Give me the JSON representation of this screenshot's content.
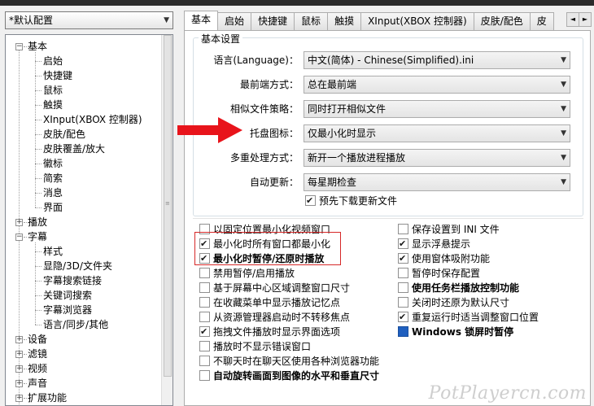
{
  "profile_select": {
    "value": "*默认配置"
  },
  "tree": {
    "items": [
      {
        "label": "基本",
        "expander": "−"
      },
      {
        "label": "启始"
      },
      {
        "label": "快捷键"
      },
      {
        "label": "鼠标"
      },
      {
        "label": "触摸"
      },
      {
        "label": "XInput(XBOX 控制器)"
      },
      {
        "label": "皮肤/配色"
      },
      {
        "label": "皮肤覆盖/放大"
      },
      {
        "label": "徽标"
      },
      {
        "label": "简索"
      },
      {
        "label": "消息"
      },
      {
        "label": "界面"
      },
      {
        "label": "播放",
        "expander": "+"
      },
      {
        "label": "字幕",
        "expander": "−"
      },
      {
        "label": "样式"
      },
      {
        "label": "显隐/3D/文件夹"
      },
      {
        "label": "字幕搜索链接"
      },
      {
        "label": "关键词搜索"
      },
      {
        "label": "字幕浏览器"
      },
      {
        "label": "语言/同步/其他"
      },
      {
        "label": "设备",
        "expander": "+"
      },
      {
        "label": "滤镜",
        "expander": "+"
      },
      {
        "label": "视频",
        "expander": "+"
      },
      {
        "label": "声音",
        "expander": "+"
      },
      {
        "label": "扩展功能",
        "expander": "+"
      }
    ]
  },
  "tabs": [
    "基本",
    "启始",
    "快捷键",
    "鼠标",
    "触摸",
    "XInput(XBOX 控制器)",
    "皮肤/配色",
    "皮"
  ],
  "tab_scroll": {
    "left": "◄",
    "right": "►"
  },
  "basic": {
    "group_title": "基本设置",
    "rows": [
      {
        "label": "语言(Language)：",
        "value": "中文(简体) - Chinese(Simplified).ini"
      },
      {
        "label": "最前端方式：",
        "value": "总在最前端"
      },
      {
        "label": "相似文件策略：",
        "value": "同时打开相似文件"
      },
      {
        "label": "托盘图标：",
        "value": "仅最小化时显示"
      },
      {
        "label": "多重处理方式：",
        "value": "新开一个播放进程播放"
      },
      {
        "label": "自动更新：",
        "value": "每星期检查"
      }
    ],
    "predownload": {
      "label": "预先下载更新文件",
      "checked": true
    }
  },
  "options_left": [
    {
      "label": "以固定位置最小化视频窗口",
      "checked": false,
      "bold": false
    },
    {
      "label": "最小化时所有窗口都最小化",
      "checked": true,
      "bold": false
    },
    {
      "label": "最小化时暂停/还原时播放",
      "checked": true,
      "bold": true
    },
    {
      "label": "禁用暂停/启用播放",
      "checked": false,
      "bold": false
    },
    {
      "label": "基于屏幕中心区域调整窗口尺寸",
      "checked": false,
      "bold": false
    },
    {
      "label": "在收藏菜单中显示播放记忆点",
      "checked": false,
      "bold": false
    },
    {
      "label": "从资源管理器启动时不转移焦点",
      "checked": false,
      "bold": false
    },
    {
      "label": "拖拽文件播放时显示界面选项",
      "checked": true,
      "bold": false
    },
    {
      "label": "播放时不显示错误窗口",
      "checked": false,
      "bold": false
    },
    {
      "label": "不聊天时在聊天区使用各种浏览器功能",
      "checked": false,
      "bold": false
    },
    {
      "label": "自动旋转画面到图像的水平和垂直尺寸",
      "checked": false,
      "bold": true
    }
  ],
  "options_right": [
    {
      "label": "保存设置到 INI 文件",
      "checked": false,
      "bold": false
    },
    {
      "label": "显示浮悬提示",
      "checked": true,
      "bold": false
    },
    {
      "label": "使用窗体吸附功能",
      "checked": true,
      "bold": false
    },
    {
      "label": "暂停时保存配置",
      "checked": false,
      "bold": false
    },
    {
      "label": "使用任务栏播放控制功能",
      "checked": false,
      "bold": true
    },
    {
      "label": "关闭时还原为默认尺寸",
      "checked": false,
      "bold": false
    },
    {
      "label": "重复运行时适当调整窗口位置",
      "checked": true,
      "bold": false
    },
    {
      "label": "Windows 锁屏时暂停",
      "checked": true,
      "bold": true
    }
  ],
  "watermark": "PotPlayercn.com",
  "colors": {
    "highlight": "#d62828",
    "arrow": "#e8141b",
    "selection": "#3399ff"
  }
}
